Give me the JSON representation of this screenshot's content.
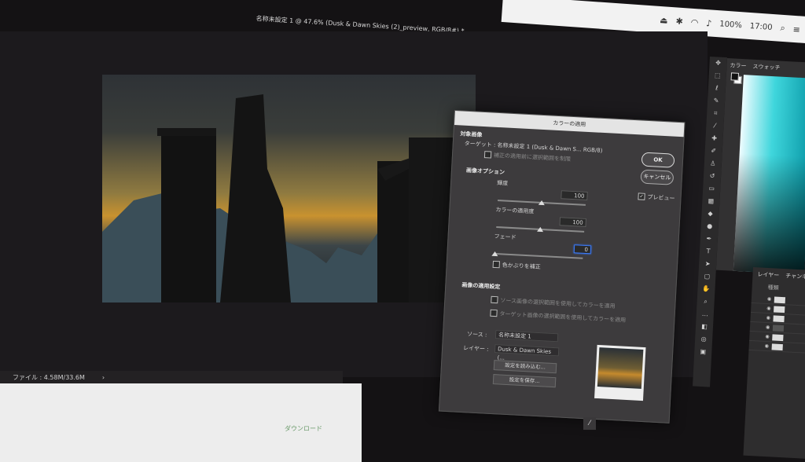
{
  "document": {
    "title": "名称未設定 1 @ 47.6% (Dusk & Dawn Skies (2)_preview, RGB/8#) *"
  },
  "menubar": {
    "battery": "100%",
    "time": "17:00"
  },
  "status": {
    "file_info": "ファイル : 4.58M/33.6M",
    "arrow": "›"
  },
  "bottom_window": {
    "label": "ダウンロード"
  },
  "dialog": {
    "title": "カラーの適用",
    "target_section": "対象画像",
    "target_text": "ターゲット :  名称未設定 1 (Dusk & Dawn S... RGB/8)",
    "target_note": "補正の適用前に選択範囲を制限",
    "options_section": "画像オプション",
    "luminance_label": "輝度",
    "luminance_value": "100",
    "luminance_percent": 50,
    "color_intensity_label": "カラーの適用度",
    "color_intensity_value": "100",
    "color_intensity_percent": 50,
    "fade_label": "フェード",
    "fade_value": "0",
    "fade_percent": 0,
    "neutralize_label": "色かぶりを補正",
    "stats_section": "画像の適用設定",
    "use_source_selection": "ソース画像の選択範囲を使用してカラーを適用",
    "use_target_selection": "ターゲット画像の選択範囲を使用してカラーを適用",
    "source_label": "ソース :",
    "source_value": "名称未設定 1",
    "layer_label": "レイヤー :",
    "layer_value": "Dusk & Dawn Skies (...",
    "load_button": "設定を読み込む...",
    "save_button": "設定を保存...",
    "ok_button": "OK",
    "cancel_button": "キャンセル",
    "preview_label": "プレビュー",
    "preview_checked": true
  },
  "panels": {
    "color_tab": "カラー",
    "swatches_tab": "スウォッチ",
    "layers_tab": "レイヤー",
    "channels_tab": "チャンネル",
    "layers_search": "種類"
  }
}
